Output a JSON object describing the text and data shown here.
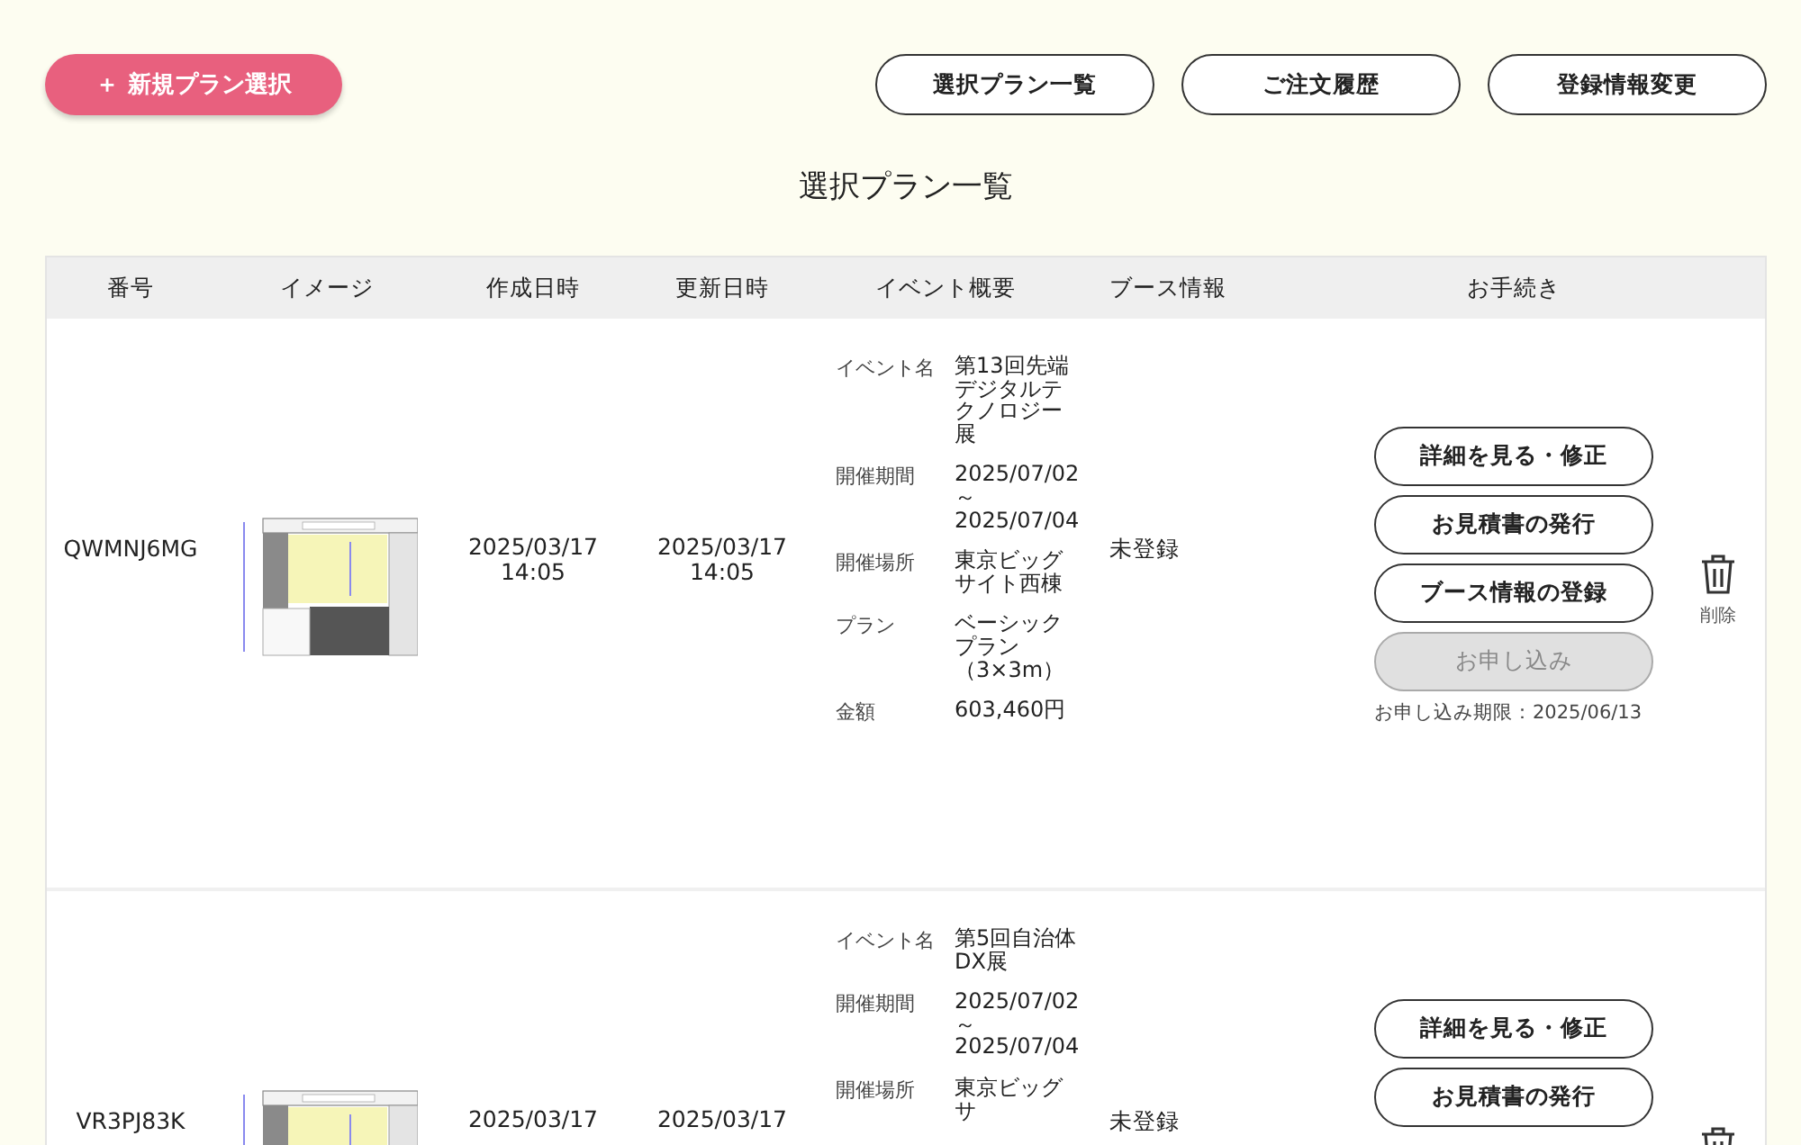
{
  "new_plan_button": {
    "icon": "＋",
    "label": "新規プラン選択"
  },
  "nav_buttons": [
    "選択プラン一覧",
    "ご注文履歴",
    "登録情報変更"
  ],
  "page_title": "選択プラン一覧",
  "table": {
    "columns": [
      "番号",
      "イメージ",
      "作成日時",
      "更新日時",
      "イベント概要",
      "ブース情報",
      "お手続き"
    ],
    "rows": [
      {
        "number": "QWMNJ6MG",
        "image": {
          "kind": "picture"
        },
        "created": "2025/03/17 14:05",
        "updated": "2025/03/17 14:05",
        "event": [
          {
            "label": "イベント名",
            "value": "第13回先端デジタルテクノロジー展"
          },
          {
            "label": "開催期間",
            "value": "2025/07/02 ～ 2025/07/04"
          },
          {
            "label": "開催場所",
            "value": "東京ビッグサイト西棟"
          },
          {
            "label": "プラン",
            "value": "ベーシックプラン（3×3m）"
          },
          {
            "label": "金額",
            "value": "603,460円"
          }
        ],
        "booth": "未登録",
        "actions": [
          {
            "label": "詳細を見る・修正",
            "disabled": false
          },
          {
            "label": "お見積書の発行",
            "disabled": false
          },
          {
            "label": "ブース情報の登録",
            "disabled": false
          },
          {
            "label": "お申し込み",
            "disabled": true
          }
        ],
        "deadline": "お申し込み期限：2025/06/13",
        "delete_label": "削除"
      },
      {
        "number": "VR3PJ83K",
        "image": {
          "kind": "picture"
        },
        "created": "2025/03/17",
        "updated": "2025/03/17",
        "event": [
          {
            "label": "イベント名",
            "value": "第5回自治体DX展"
          },
          {
            "label": "開催期間",
            "value": "2025/07/02 ～ 2025/07/04"
          },
          {
            "label": "開催場所",
            "value": "東京ビッグサ"
          }
        ],
        "booth": "未登録",
        "actions": [
          {
            "label": "詳細を見る・修正",
            "disabled": false
          },
          {
            "label": "お見積書の発行",
            "disabled": false
          }
        ]
      }
    ]
  }
}
